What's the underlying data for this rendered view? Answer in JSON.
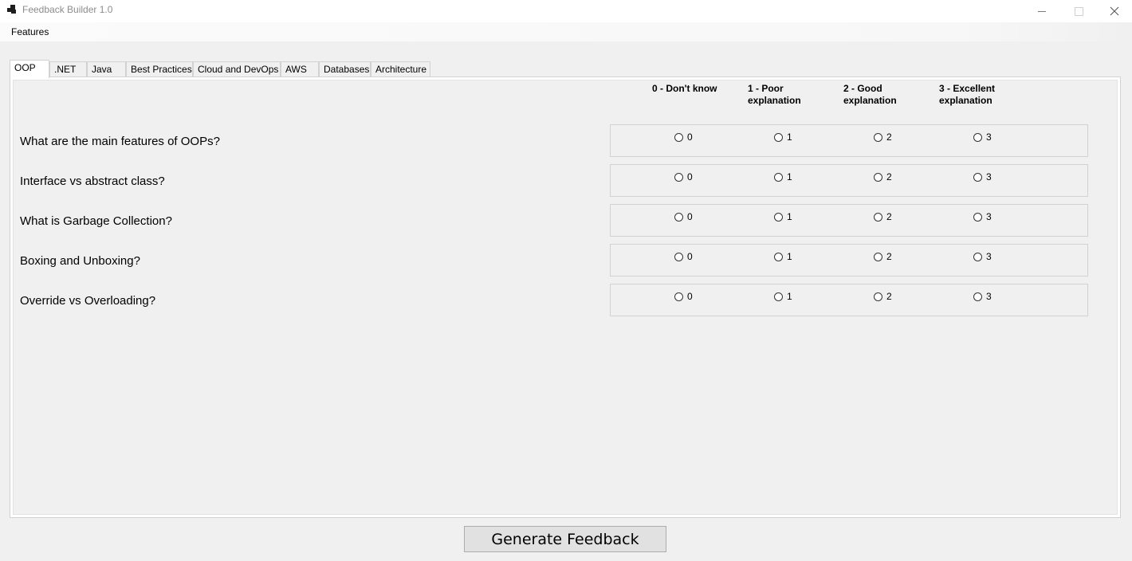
{
  "window": {
    "title": "Feedback Builder 1.0"
  },
  "menu": {
    "items": [
      "Features"
    ]
  },
  "tabs": [
    {
      "label": "OOP",
      "active": true
    },
    {
      "label": ".NET",
      "active": false
    },
    {
      "label": "Java",
      "active": false
    },
    {
      "label": "Best Practices",
      "active": false
    },
    {
      "label": "Cloud and DevOps",
      "active": false
    },
    {
      "label": "AWS",
      "active": false
    },
    {
      "label": "Databases",
      "active": false
    },
    {
      "label": "Architecture",
      "active": false
    }
  ],
  "rating_headers": [
    "0 - Don't know",
    "1 - Poor\nexplanation",
    "2 - Good\nexplanation",
    "3 - Excellent\nexplanation"
  ],
  "questions": [
    {
      "text": "What are the main features of OOPs?",
      "options": [
        "0",
        "1",
        "2",
        "3"
      ]
    },
    {
      "text": "Interface vs abstract class?",
      "options": [
        "0",
        "1",
        "2",
        "3"
      ]
    },
    {
      "text": "What is Garbage Collection?",
      "options": [
        "0",
        "1",
        "2",
        "3"
      ]
    },
    {
      "text": "Boxing and Unboxing?",
      "options": [
        "0",
        "1",
        "2",
        "3"
      ]
    },
    {
      "text": "Override vs Overloading?",
      "options": [
        "0",
        "1",
        "2",
        "3"
      ]
    }
  ],
  "actions": {
    "generate_label": "Generate Feedback"
  },
  "icons": {
    "app": "app-icon",
    "minimize": "minimize-icon",
    "maximize": "maximize-icon",
    "close": "close-icon"
  }
}
